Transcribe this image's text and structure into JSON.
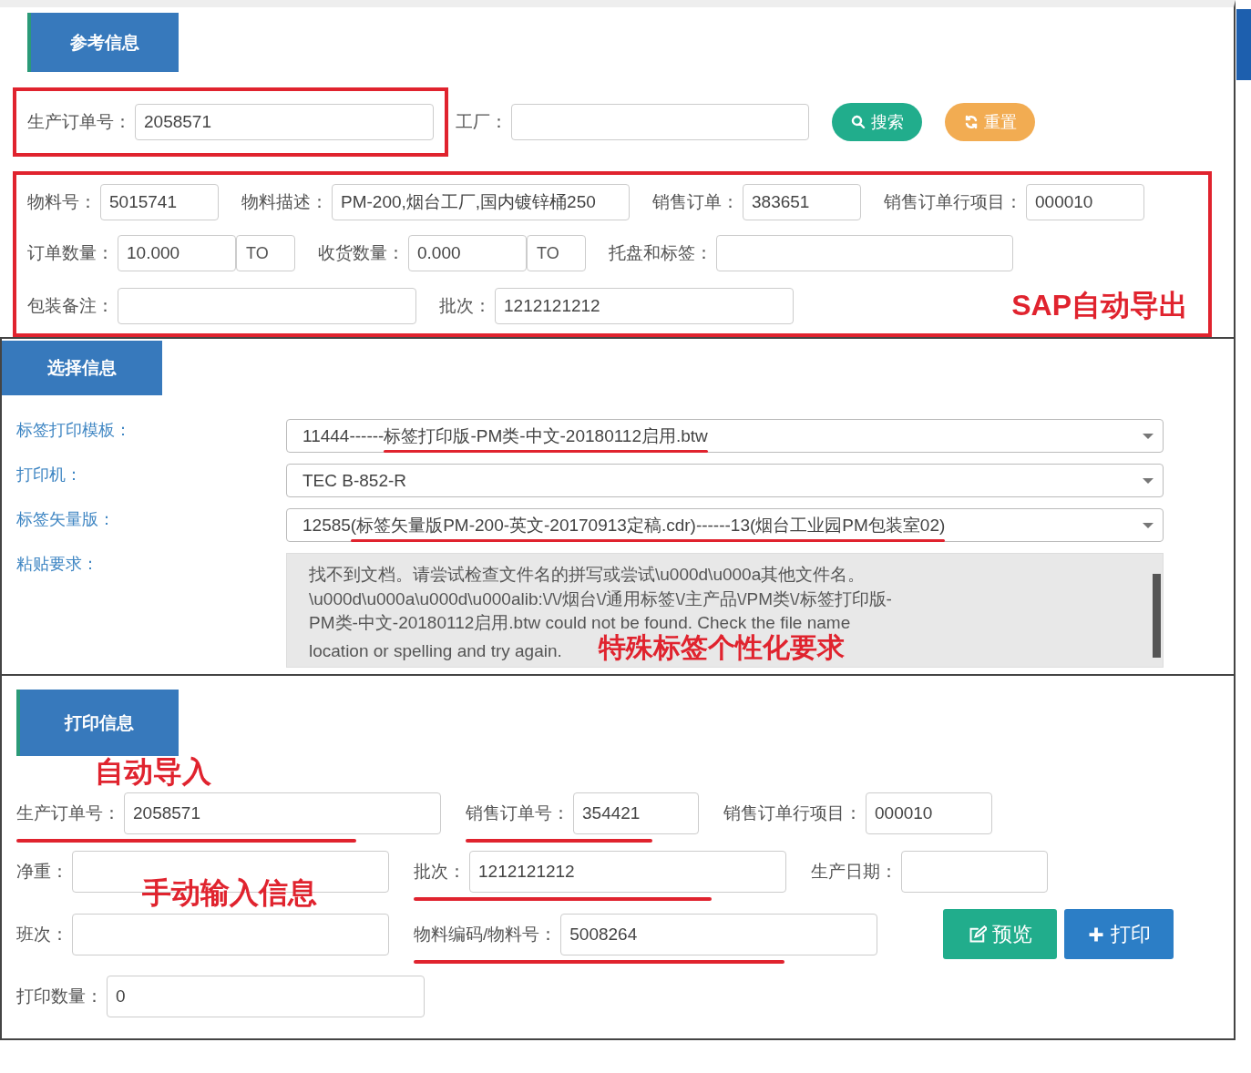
{
  "sections": [
    {
      "title": "参考信息",
      "blocks": [
        {
          "rows": [
            {
              "items": [
                {
                  "kind": "field",
                  "label": "生产订单号：",
                  "value": "2058571",
                  "boxed": true
                },
                {
                  "kind": "field",
                  "label": "工厂："
                },
                {
                  "kind": "button",
                  "label": "搜索"
                },
                {
                  "kind": "button",
                  "label": "重置"
                }
              ]
            }
          ]
        },
        {
          "boxed": true,
          "rows": [
            {
              "items": [
                {
                  "kind": "field",
                  "label": "物料号：",
                  "value": "5015741"
                },
                {
                  "kind": "field",
                  "label": "物料描述：",
                  "value": "PM-200,烟台工厂,国内镀锌桶250"
                },
                {
                  "kind": "field",
                  "label": "销售订单：",
                  "value": "383651"
                },
                {
                  "kind": "field",
                  "label": "销售订单行项目：",
                  "value": "000010"
                }
              ]
            },
            {
              "items": [
                {
                  "kind": "field",
                  "label": "订单数量：",
                  "value": "10.000",
                  "unit": "TO"
                },
                {
                  "kind": "field",
                  "label": "收货数量：",
                  "value": "0.000",
                  "unit": "TO"
                },
                {
                  "kind": "field",
                  "label": "托盘和标签："
                }
              ]
            },
            {
              "items": [
                {
                  "kind": "field",
                  "label": "包装备注："
                },
                {
                  "kind": "field",
                  "label": "批次：",
                  "value": "1212121212"
                },
                {
                  "kind": "note",
                  "text": "SAP自动导出"
                }
              ]
            }
          ]
        }
      ]
    },
    {
      "title": "选择信息",
      "blocks": [
        {
          "rows": [
            {
              "items": [
                {
                  "kind": "select",
                  "label": "标签打印模板：",
                  "prefix": "11444------",
                  "value": "标签打印版-PM类-中文-20180112启用.btw",
                  "underlined": true
                }
              ]
            },
            {
              "items": [
                {
                  "kind": "select",
                  "label": "打印机：",
                  "value": "TEC B-852-R",
                  "underlined": false
                }
              ]
            },
            {
              "items": [
                {
                  "kind": "select",
                  "label": "标签矢量版：",
                  "prefix": "12585",
                  "value": "(标签矢量版PM-200-英文-20170913定稿.cdr)------13(烟台工业园PM包装室02)",
                  "underlined": true
                }
              ]
            },
            {
              "items": [
                {
                  "kind": "textarea",
                  "label": "粘贴要求：",
                  "lines": [
                    "找不到文档。请尝试检查文件名的拼写或尝试\\u000d\\u000a其他文件名。",
                    "\\u000d\\u000a\\u000d\\u000alib:\\/\\/烟台\\/通用标签\\/主产品\\/PM类\\/标签打印版-",
                    "PM类-中文-20180112启用.btw could not be found. Check the file name",
                    "location or spelling and try again."
                  ],
                  "note": "特殊标签个性化要求"
                }
              ]
            }
          ]
        }
      ]
    },
    {
      "title": "打印信息",
      "blocks": [
        {
          "rows": [
            {
              "items": [
                {
                  "kind": "field",
                  "label": "生产订单号：",
                  "value": "2058571",
                  "underlined": true,
                  "note": "自动导入"
                },
                {
                  "kind": "field",
                  "label": "销售订单号：",
                  "value": "354421",
                  "underlined": true
                },
                {
                  "kind": "field",
                  "label": "销售订单行项目：",
                  "value": "000010",
                  "underlined": false
                }
              ]
            },
            {
              "items": [
                {
                  "kind": "field",
                  "label": "净重：",
                  "underlined": false
                },
                {
                  "kind": "field",
                  "label": "批次：",
                  "value": "1212121212",
                  "underlined": true
                },
                {
                  "kind": "field",
                  "label": "生产日期：",
                  "underlined": false
                }
              ]
            },
            {
              "items": [
                {
                  "kind": "field",
                  "label": "班次：",
                  "underlined": false,
                  "note": "手动输入信息"
                },
                {
                  "kind": "field",
                  "label": "物料编码/物料号：",
                  "value": "5008264",
                  "underlined": true
                },
                {
                  "kind": "button",
                  "label": "预览"
                },
                {
                  "kind": "button",
                  "label": "打印"
                }
              ]
            },
            {
              "items": [
                {
                  "kind": "field",
                  "label": "打印数量：",
                  "value": "0",
                  "underlined": false
                }
              ]
            }
          ]
        }
      ]
    }
  ]
}
